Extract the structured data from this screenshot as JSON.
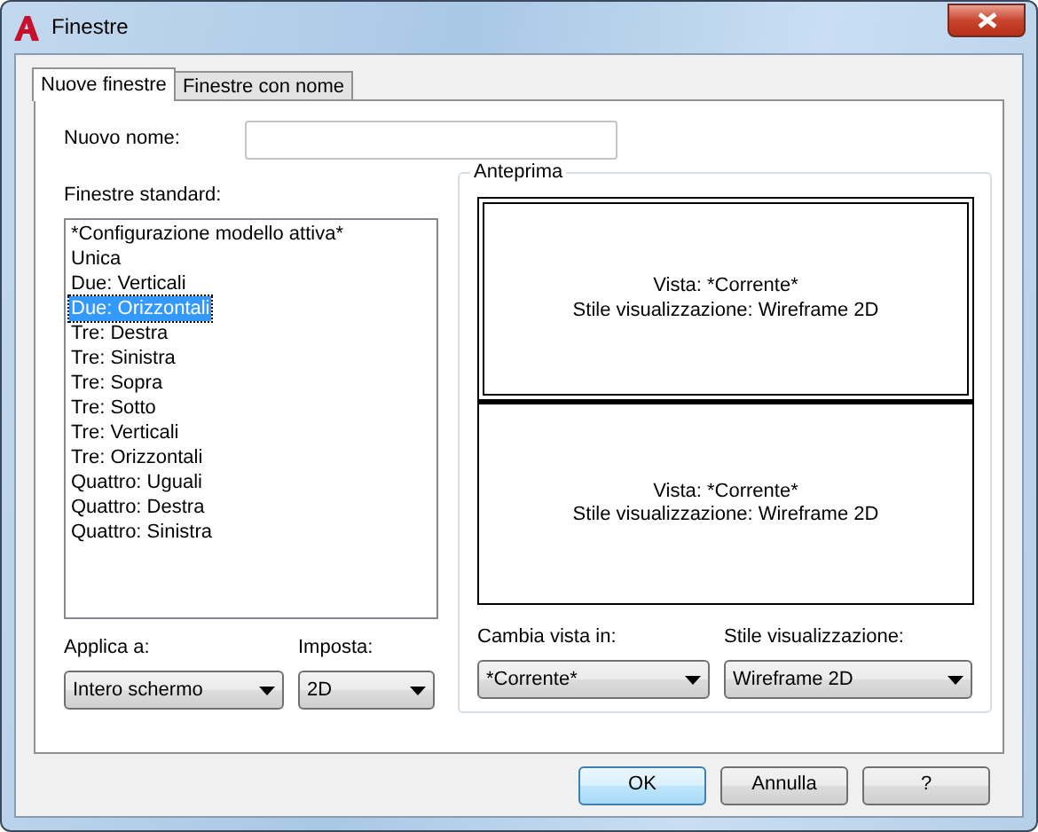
{
  "window": {
    "title": "Finestre"
  },
  "tabs": [
    {
      "label": "Nuove finestre",
      "selected": true
    },
    {
      "label": "Finestre con nome",
      "selected": false
    }
  ],
  "new_name": {
    "label": "Nuovo nome:"
  },
  "standard_viewports": {
    "label": "Finestre standard:",
    "items": [
      {
        "label": "*Configurazione modello attiva*",
        "selected": false
      },
      {
        "label": "Unica",
        "selected": false
      },
      {
        "label": "Due: Verticali",
        "selected": false
      },
      {
        "label": "Due: Orizzontali",
        "selected": true
      },
      {
        "label": "Tre: Destra",
        "selected": false
      },
      {
        "label": "Tre: Sinistra",
        "selected": false
      },
      {
        "label": "Tre: Sopra",
        "selected": false
      },
      {
        "label": "Tre: Sotto",
        "selected": false
      },
      {
        "label": "Tre: Verticali",
        "selected": false
      },
      {
        "label": "Tre: Orizzontali",
        "selected": false
      },
      {
        "label": "Quattro: Uguali",
        "selected": false
      },
      {
        "label": "Quattro: Destra",
        "selected": false
      },
      {
        "label": "Quattro: Sinistra",
        "selected": false
      }
    ]
  },
  "preview": {
    "title": "Anteprima",
    "panes": [
      {
        "view": "Vista: *Corrente*",
        "style": "Stile visualizzazione: Wireframe 2D",
        "selected": true
      },
      {
        "view": "Vista: *Corrente*",
        "style": "Stile visualizzazione: Wireframe 2D",
        "selected": false
      }
    ]
  },
  "left_dropdowns": [
    {
      "label": "Applica a:",
      "value": "Intero schermo"
    },
    {
      "label": "Imposta:",
      "value": "2D"
    }
  ],
  "right_dropdowns": [
    {
      "label": "Cambia vista in:",
      "value": "*Corrente*"
    },
    {
      "label": "Stile visualizzazione:",
      "value": "Wireframe 2D"
    }
  ],
  "buttons": [
    {
      "label": "OK",
      "default": true
    },
    {
      "label": "Annulla",
      "default": false
    },
    {
      "label": "?",
      "default": false
    }
  ]
}
